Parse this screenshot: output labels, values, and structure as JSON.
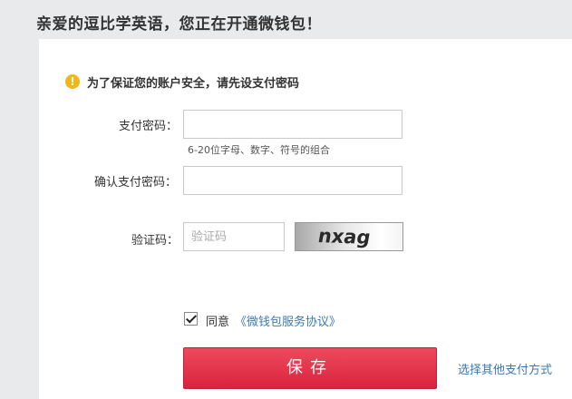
{
  "header": {
    "title": "亲爱的逗比学英语，您正在开通微钱包！"
  },
  "notice": {
    "icon": "exclamation-icon",
    "text": "为了保证您的账户安全，请先设支付密码"
  },
  "form": {
    "pay_password_label": "支付密码：",
    "pay_password_hint": "6-20位字母、数字、符号的组合",
    "confirm_password_label": "确认支付密码：",
    "captcha_label": "验证码：",
    "captcha_placeholder": "验证码",
    "captcha_text": "nxag"
  },
  "agreement": {
    "prefix": "同意",
    "link": "《微钱包服务协议》",
    "checked": true
  },
  "actions": {
    "save_label": "保存",
    "other_payment_label": "选择其他支付方式"
  },
  "colors": {
    "accent_red": "#e03448",
    "link_blue": "#3c78b4",
    "notice_yellow": "#f2b61d"
  }
}
